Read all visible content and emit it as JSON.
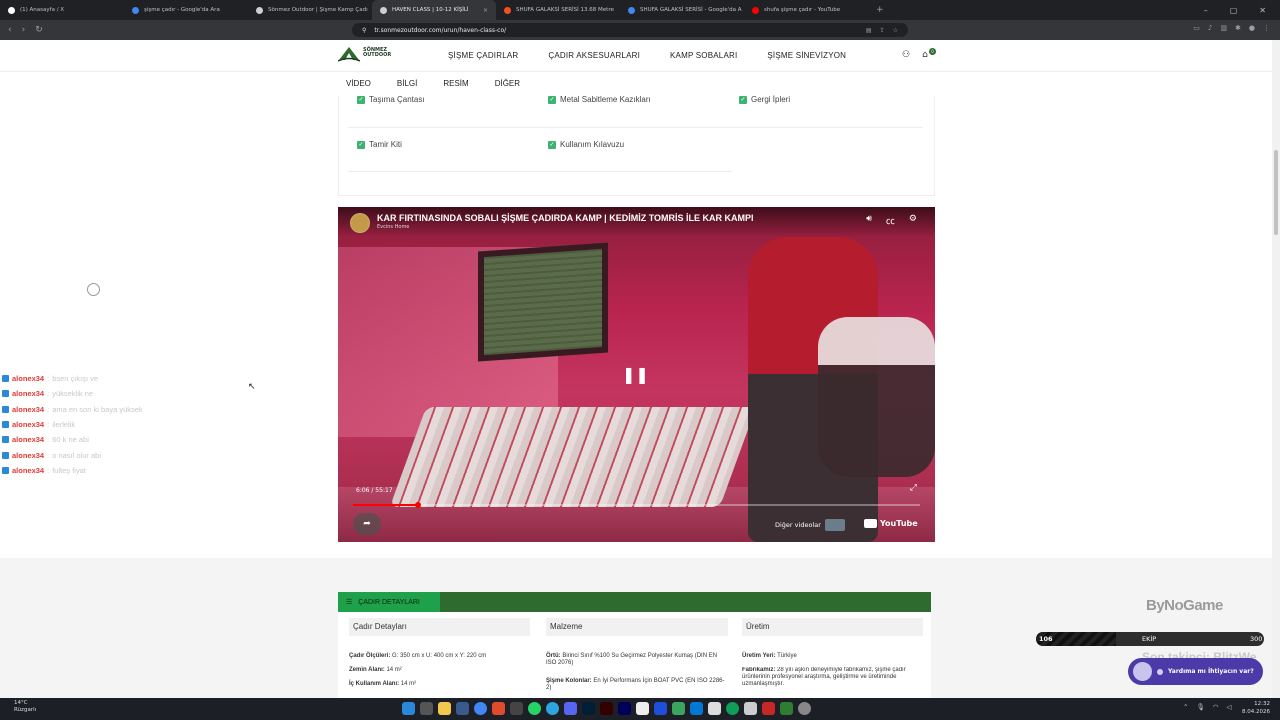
{
  "browser": {
    "tabs": [
      {
        "label": "(1) Anasayfa / X",
        "icon": "x-icon",
        "color": "#ffffff",
        "active": false
      },
      {
        "label": "şişme çadır - Google'da Ara",
        "icon": "google-icon",
        "color": "#4285f4",
        "active": false
      },
      {
        "label": "Sönmez Outdoor | Şişme Kamp Çadı",
        "icon": "site-icon",
        "color": "#cfcfcf",
        "active": false
      },
      {
        "label": "HAVEN CLASS | 10-12 KİŞİLİ",
        "icon": "site-icon",
        "color": "#cfcfcf",
        "active": true
      },
      {
        "label": "SHUFA GALAKSİ SERİSİ 13.68 Metre",
        "icon": "shop-icon",
        "color": "#f4511e",
        "active": false
      },
      {
        "label": "SHUFA GALAKSİ SERİSİ - Google'da A",
        "icon": "google-icon",
        "color": "#4285f4",
        "active": false
      },
      {
        "label": "shufa şişme çadır - YouTube",
        "icon": "youtube-icon",
        "color": "#ff0000",
        "active": false
      }
    ],
    "url": "tr.sonmezoutdoor.com/urun/haven-class-co/"
  },
  "site": {
    "logo_text_1": "SÖNMEZ",
    "logo_text_2": "OUTDOOR",
    "nav": [
      "ŞİŞME ÇADIRLAR",
      "ÇADIR AKSESUARLARI",
      "KAMP SOBALARI",
      "ŞİŞME SİNEVİZYON"
    ],
    "subnav": [
      "VİDEO",
      "BİLGİ",
      "RESİM",
      "DİĞER"
    ],
    "cart_count": "0"
  },
  "accessories": [
    {
      "label": "Taşıma Çantası"
    },
    {
      "label": "Metal Sabitleme Kazıkları"
    },
    {
      "label": "Gergi İpleri"
    },
    {
      "label": "Tamir Kiti"
    },
    {
      "label": "Kullanım Kılavuzu"
    }
  ],
  "chat": [
    {
      "user": "alonex34",
      "msg": "bsen çıkışı ve"
    },
    {
      "user": "alonex34",
      "msg": "yükseklik ne"
    },
    {
      "user": "alonex34",
      "msg": "ama en son ki baya yüksek"
    },
    {
      "user": "alonex34",
      "msg": "ilerlelik"
    },
    {
      "user": "alonex34",
      "msg": "60 k ne abi"
    },
    {
      "user": "alonex34",
      "msg": "o nasıl olur abi"
    },
    {
      "user": "alonex34",
      "msg": "fulteş fiyat"
    }
  ],
  "video": {
    "title": "KAR FIRTINASINDA SOBALI ŞİŞME ÇADIRDA KAMP | KEDİMİZ TOMRİS İLE KAR KAMPI",
    "channel": "Evcins Home",
    "time": "6:06 / 55:17",
    "progress": 0.115,
    "more_videos": "Diğer videolar",
    "youtube": "YouTube"
  },
  "details": {
    "tab_label": "ÇADIR DETAYLARI",
    "columns": [
      {
        "heading": "Çadır Detayları",
        "lines": [
          {
            "key": "Çadır Ölçüleri:",
            "val": " G: 350 cm x U: 400 cm x Y: 220 cm"
          },
          {
            "key": "Zemin Alanı:",
            "val": " 14 m²"
          },
          {
            "key": "İç Kullanım Alanı:",
            "val": " 14 m²"
          }
        ]
      },
      {
        "heading": "Malzeme",
        "lines": [
          {
            "key": "Örtü:",
            "val": " Birinci Sınıf %100 Su Geçirmez Polyester Kumaş (DIN EN ISO 2076)"
          },
          {
            "key": "Şişme Kolonlar:",
            "val": " En İyi Performans İçin BOAT PVC (EN ISO 2286-2)"
          }
        ]
      },
      {
        "heading": "Üretim",
        "lines": [
          {
            "key": "Üretim Yeri:",
            "val": " Türkiye"
          },
          {
            "key": "Fabrikamız:",
            "val": " 28 yılı aşkın deneyimiyle fabrikamız, şişme çadır ürünlerinin profesyonel araştırma, geliştirme ve üretiminde uzmanlaşmıştır."
          }
        ]
      }
    ]
  },
  "overlays": {
    "brand": "ByNoGame",
    "ekip_left": "106",
    "ekip_mid": "EKİP",
    "ekip_right": "300",
    "ekip_fill": 0.35,
    "takip": "Son takipçi: BlitzWe",
    "help": "Yardıma mı İhtiyacın var?"
  },
  "taskbar": {
    "weather_temp": "14°C",
    "weather_desc": "Rüzgarlı",
    "time": "12:32",
    "date": "8.04.2026"
  },
  "colors": {
    "brand_green": "#2e6b2e",
    "check_green": "#3cb371",
    "chat_user": "#e53935",
    "youtube_red": "#ff0000"
  }
}
